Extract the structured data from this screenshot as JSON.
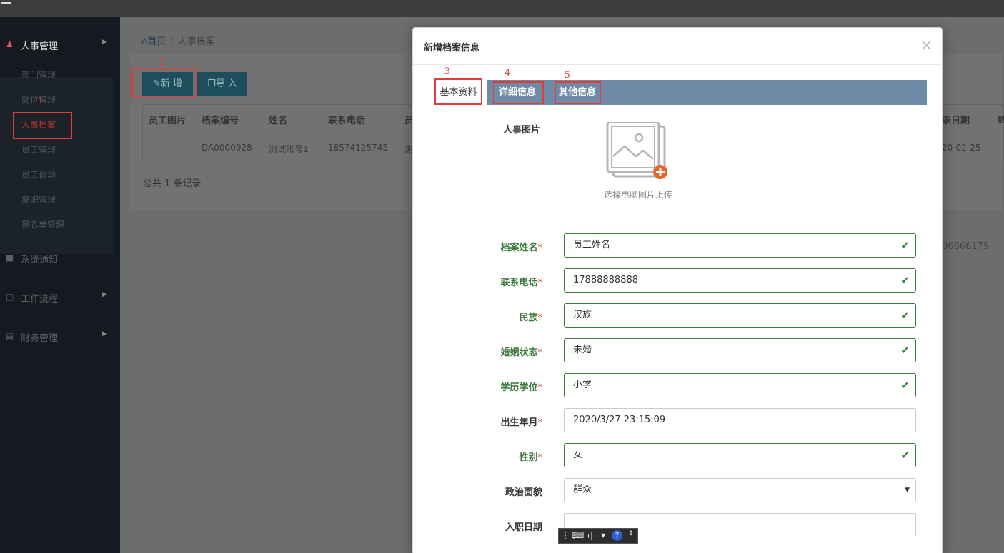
{
  "sidebar": {
    "groups": [
      {
        "label": "人事管理",
        "icon": "user-icon"
      },
      {
        "label": "系统通知",
        "icon": "book-icon"
      },
      {
        "label": "工作流程",
        "icon": "external-link-icon"
      },
      {
        "label": "财务管理",
        "icon": "server-icon"
      }
    ],
    "items": [
      "部门管理",
      "岗位管理",
      "人事档案",
      "员工管理",
      "员工调动",
      "离职管理",
      "黑名单管理"
    ]
  },
  "breadcrumb": {
    "home": "首页",
    "current": "人事档案"
  },
  "toolbar": {
    "add_label": "新 增",
    "import_label": "导 入"
  },
  "table": {
    "headers": [
      "员工图片",
      "档案编号",
      "姓名",
      "联系电话",
      "员"
    ],
    "header_right": [
      "职日期",
      "转"
    ],
    "row": [
      "DA0000028",
      "测试账号1",
      "18574125745",
      "测"
    ],
    "row_right": [
      "20-02-25",
      "-"
    ],
    "total": "总共 1 条记录"
  },
  "background_phone": "06666179",
  "annotations": [
    "1",
    "2",
    "3",
    "4",
    "5"
  ],
  "modal": {
    "title": "新增档案信息",
    "close": "×",
    "tabs": [
      "基本资料",
      "详细信息",
      "其他信息"
    ],
    "photo_label": "人事图片",
    "photo_hint": "选择电脑图片上传",
    "fields": [
      {
        "label": "档案姓名",
        "required": "*",
        "value": "员工姓名",
        "status": "valid"
      },
      {
        "label": "联系电话",
        "required": "*",
        "value": "17888888888",
        "status": "valid"
      },
      {
        "label": "民族",
        "required": "*",
        "value": "汉族",
        "status": "valid"
      },
      {
        "label": "婚姻状态",
        "required": "*",
        "value": "未婚",
        "status": "valid"
      },
      {
        "label": "学历学位",
        "required": "*",
        "value": "小学",
        "status": "valid"
      },
      {
        "label": "出生年月",
        "required": "*",
        "value": "2020/3/27 23:15:09",
        "status": "none"
      },
      {
        "label": "性别",
        "required": "*",
        "value": "女",
        "status": "valid"
      },
      {
        "label": "政治面貌",
        "required": "",
        "value": "群众",
        "status": "select"
      },
      {
        "label": "入职日期",
        "required": "",
        "value": "",
        "status": "none"
      }
    ]
  },
  "ime": {
    "mode": "中"
  },
  "colors": {
    "valid": "#3c7a3c",
    "annotation": "#e03c3c",
    "tab_strip": "#6f8aa6"
  }
}
